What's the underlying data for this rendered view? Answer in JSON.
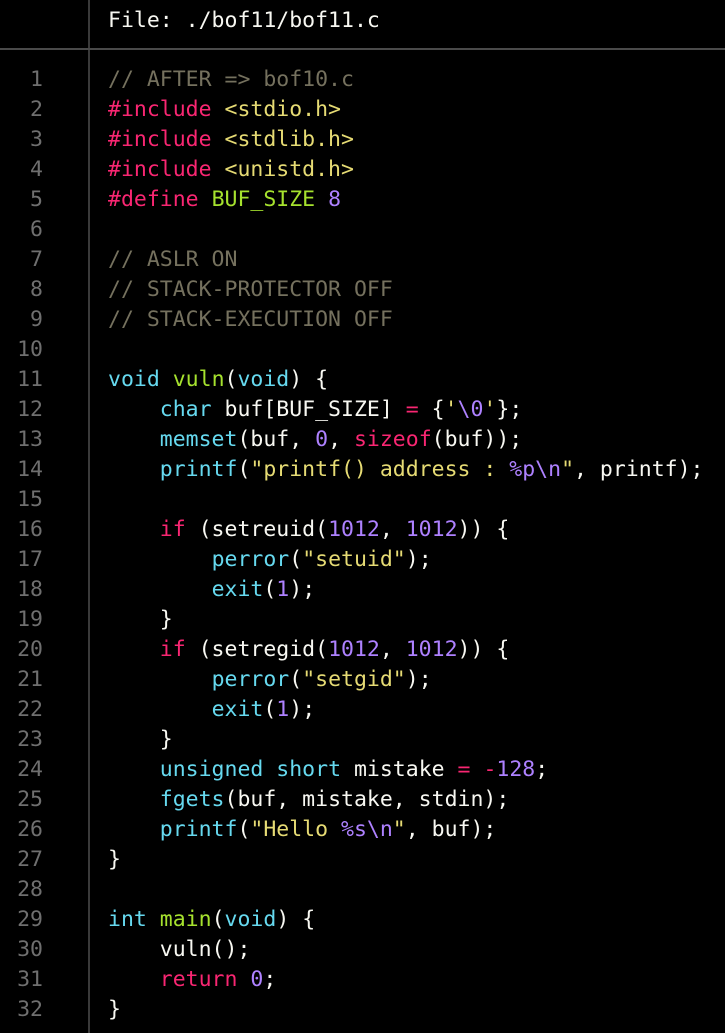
{
  "file_label": "File: ./bof11/bof11.c",
  "colors": {
    "background": "#000000",
    "default": "#f8f8f2",
    "comment": "#75715e",
    "preprocessor": "#f92672",
    "keyword": "#f92672",
    "type": "#66d9ef",
    "function": "#a6e22e",
    "builtin": "#66d9ef",
    "string": "#e6db74",
    "number": "#ae81ff",
    "line_number": "#6f6f6f"
  },
  "lines": [
    {
      "num": "1",
      "tokens": [
        {
          "t": "// AFTER => bof10.c",
          "c": "comment"
        }
      ]
    },
    {
      "num": "2",
      "tokens": [
        {
          "t": "#include ",
          "c": "preprocessor"
        },
        {
          "t": "<stdio.h>",
          "c": "string"
        }
      ]
    },
    {
      "num": "3",
      "tokens": [
        {
          "t": "#include ",
          "c": "preprocessor"
        },
        {
          "t": "<stdlib.h>",
          "c": "string"
        }
      ]
    },
    {
      "num": "4",
      "tokens": [
        {
          "t": "#include ",
          "c": "preprocessor"
        },
        {
          "t": "<unistd.h>",
          "c": "string"
        }
      ]
    },
    {
      "num": "5",
      "tokens": [
        {
          "t": "#define ",
          "c": "preprocessor"
        },
        {
          "t": "BUF_SIZE",
          "c": "function"
        },
        {
          "t": " "
        },
        {
          "t": "8",
          "c": "number"
        }
      ]
    },
    {
      "num": "6",
      "tokens": []
    },
    {
      "num": "7",
      "tokens": [
        {
          "t": "// ASLR ON",
          "c": "comment"
        }
      ]
    },
    {
      "num": "8",
      "tokens": [
        {
          "t": "// STACK-PROTECTOR OFF",
          "c": "comment"
        }
      ]
    },
    {
      "num": "9",
      "tokens": [
        {
          "t": "// STACK-EXECUTION OFF",
          "c": "comment"
        }
      ]
    },
    {
      "num": "10",
      "tokens": []
    },
    {
      "num": "11",
      "tokens": [
        {
          "t": "void",
          "c": "type"
        },
        {
          "t": " "
        },
        {
          "t": "vuln",
          "c": "function"
        },
        {
          "t": "("
        },
        {
          "t": "void",
          "c": "type"
        },
        {
          "t": ") {"
        }
      ]
    },
    {
      "num": "12",
      "tokens": [
        {
          "t": "    "
        },
        {
          "t": "char",
          "c": "type"
        },
        {
          "t": " buf[BUF_SIZE] "
        },
        {
          "t": "=",
          "c": "keyword"
        },
        {
          "t": " {"
        },
        {
          "t": "'",
          "c": "string"
        },
        {
          "t": "\\0",
          "c": "number"
        },
        {
          "t": "'",
          "c": "string"
        },
        {
          "t": "};"
        }
      ]
    },
    {
      "num": "13",
      "tokens": [
        {
          "t": "    "
        },
        {
          "t": "memset",
          "c": "builtin"
        },
        {
          "t": "(buf, "
        },
        {
          "t": "0",
          "c": "number"
        },
        {
          "t": ", "
        },
        {
          "t": "sizeof",
          "c": "keyword"
        },
        {
          "t": "(buf));"
        }
      ]
    },
    {
      "num": "14",
      "tokens": [
        {
          "t": "    "
        },
        {
          "t": "printf",
          "c": "builtin"
        },
        {
          "t": "("
        },
        {
          "t": "\"printf() address : ",
          "c": "string"
        },
        {
          "t": "%p\\n",
          "c": "number"
        },
        {
          "t": "\"",
          "c": "string"
        },
        {
          "t": ", printf);"
        }
      ]
    },
    {
      "num": "15",
      "tokens": []
    },
    {
      "num": "16",
      "tokens": [
        {
          "t": "    "
        },
        {
          "t": "if",
          "c": "keyword"
        },
        {
          "t": " (setreuid("
        },
        {
          "t": "1012",
          "c": "number"
        },
        {
          "t": ", "
        },
        {
          "t": "1012",
          "c": "number"
        },
        {
          "t": ")) {"
        }
      ]
    },
    {
      "num": "17",
      "tokens": [
        {
          "t": "        "
        },
        {
          "t": "perror",
          "c": "builtin"
        },
        {
          "t": "("
        },
        {
          "t": "\"setuid\"",
          "c": "string"
        },
        {
          "t": ");"
        }
      ]
    },
    {
      "num": "18",
      "tokens": [
        {
          "t": "        "
        },
        {
          "t": "exit",
          "c": "builtin"
        },
        {
          "t": "("
        },
        {
          "t": "1",
          "c": "number"
        },
        {
          "t": ");"
        }
      ]
    },
    {
      "num": "19",
      "tokens": [
        {
          "t": "    }"
        }
      ]
    },
    {
      "num": "20",
      "tokens": [
        {
          "t": "    "
        },
        {
          "t": "if",
          "c": "keyword"
        },
        {
          "t": " (setregid("
        },
        {
          "t": "1012",
          "c": "number"
        },
        {
          "t": ", "
        },
        {
          "t": "1012",
          "c": "number"
        },
        {
          "t": ")) {"
        }
      ]
    },
    {
      "num": "21",
      "tokens": [
        {
          "t": "        "
        },
        {
          "t": "perror",
          "c": "builtin"
        },
        {
          "t": "("
        },
        {
          "t": "\"setgid\"",
          "c": "string"
        },
        {
          "t": ");"
        }
      ]
    },
    {
      "num": "22",
      "tokens": [
        {
          "t": "        "
        },
        {
          "t": "exit",
          "c": "builtin"
        },
        {
          "t": "("
        },
        {
          "t": "1",
          "c": "number"
        },
        {
          "t": ");"
        }
      ]
    },
    {
      "num": "23",
      "tokens": [
        {
          "t": "    }"
        }
      ]
    },
    {
      "num": "24",
      "tokens": [
        {
          "t": "    "
        },
        {
          "t": "unsigned",
          "c": "type"
        },
        {
          "t": " "
        },
        {
          "t": "short",
          "c": "type"
        },
        {
          "t": " mistake "
        },
        {
          "t": "=",
          "c": "keyword"
        },
        {
          "t": " "
        },
        {
          "t": "-",
          "c": "keyword"
        },
        {
          "t": "128",
          "c": "number"
        },
        {
          "t": ";"
        }
      ]
    },
    {
      "num": "25",
      "tokens": [
        {
          "t": "    "
        },
        {
          "t": "fgets",
          "c": "builtin"
        },
        {
          "t": "(buf, mistake, stdin);"
        }
      ]
    },
    {
      "num": "26",
      "tokens": [
        {
          "t": "    "
        },
        {
          "t": "printf",
          "c": "builtin"
        },
        {
          "t": "("
        },
        {
          "t": "\"Hello ",
          "c": "string"
        },
        {
          "t": "%s\\n",
          "c": "number"
        },
        {
          "t": "\"",
          "c": "string"
        },
        {
          "t": ", buf);"
        }
      ]
    },
    {
      "num": "27",
      "tokens": [
        {
          "t": "}"
        }
      ]
    },
    {
      "num": "28",
      "tokens": []
    },
    {
      "num": "29",
      "tokens": [
        {
          "t": "int",
          "c": "type"
        },
        {
          "t": " "
        },
        {
          "t": "main",
          "c": "function"
        },
        {
          "t": "("
        },
        {
          "t": "void",
          "c": "type"
        },
        {
          "t": ") {"
        }
      ]
    },
    {
      "num": "30",
      "tokens": [
        {
          "t": "    vuln();"
        }
      ]
    },
    {
      "num": "31",
      "tokens": [
        {
          "t": "    "
        },
        {
          "t": "return",
          "c": "keyword"
        },
        {
          "t": " "
        },
        {
          "t": "0",
          "c": "number"
        },
        {
          "t": ";"
        }
      ]
    },
    {
      "num": "32",
      "tokens": [
        {
          "t": "}"
        }
      ]
    }
  ]
}
